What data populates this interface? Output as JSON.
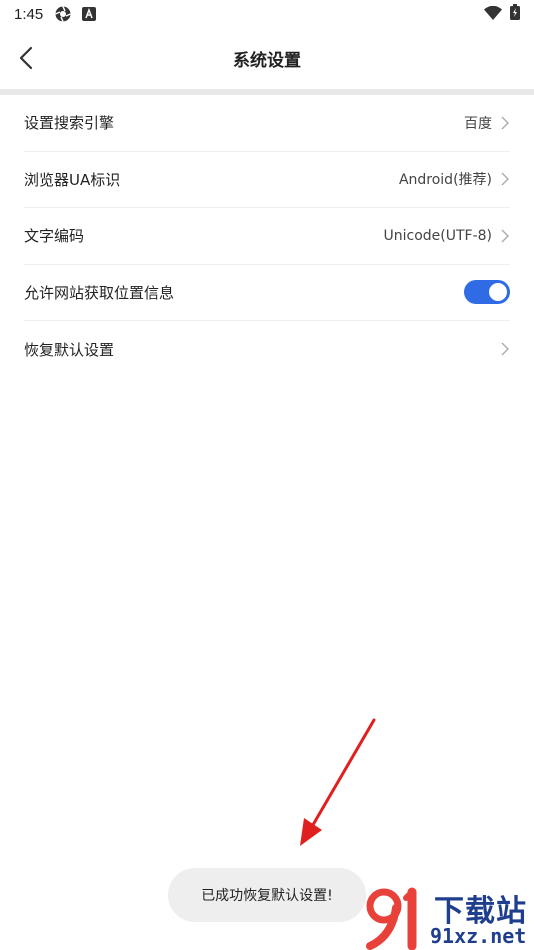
{
  "status_bar": {
    "time": "1:45",
    "icons_left": [
      "aperture-icon",
      "a-badge-icon"
    ],
    "icons_right": [
      "wifi-icon",
      "battery-charging-icon"
    ]
  },
  "header": {
    "title": "系统设置",
    "back_icon": "chevron-left-icon"
  },
  "settings": [
    {
      "label": "设置搜索引擎",
      "value": "百度"
    },
    {
      "label": "浏览器UA标识",
      "value": "Android(推荐)"
    },
    {
      "label": "文字编码",
      "value": "Unicode(UTF-8)"
    },
    {
      "label": "允许网站获取位置信息",
      "toggle_on": true
    },
    {
      "label": "恢复默认设置",
      "value": ""
    }
  ],
  "toast": {
    "message": "已成功恢复默认设置!"
  },
  "watermark": {
    "cn": "下载站",
    "en": "91xz.net"
  },
  "colors": {
    "accent": "#2f6be4",
    "arrow": "#e01f1f",
    "divider": "#e8e8e8",
    "watermark": "#1f3e8e"
  }
}
